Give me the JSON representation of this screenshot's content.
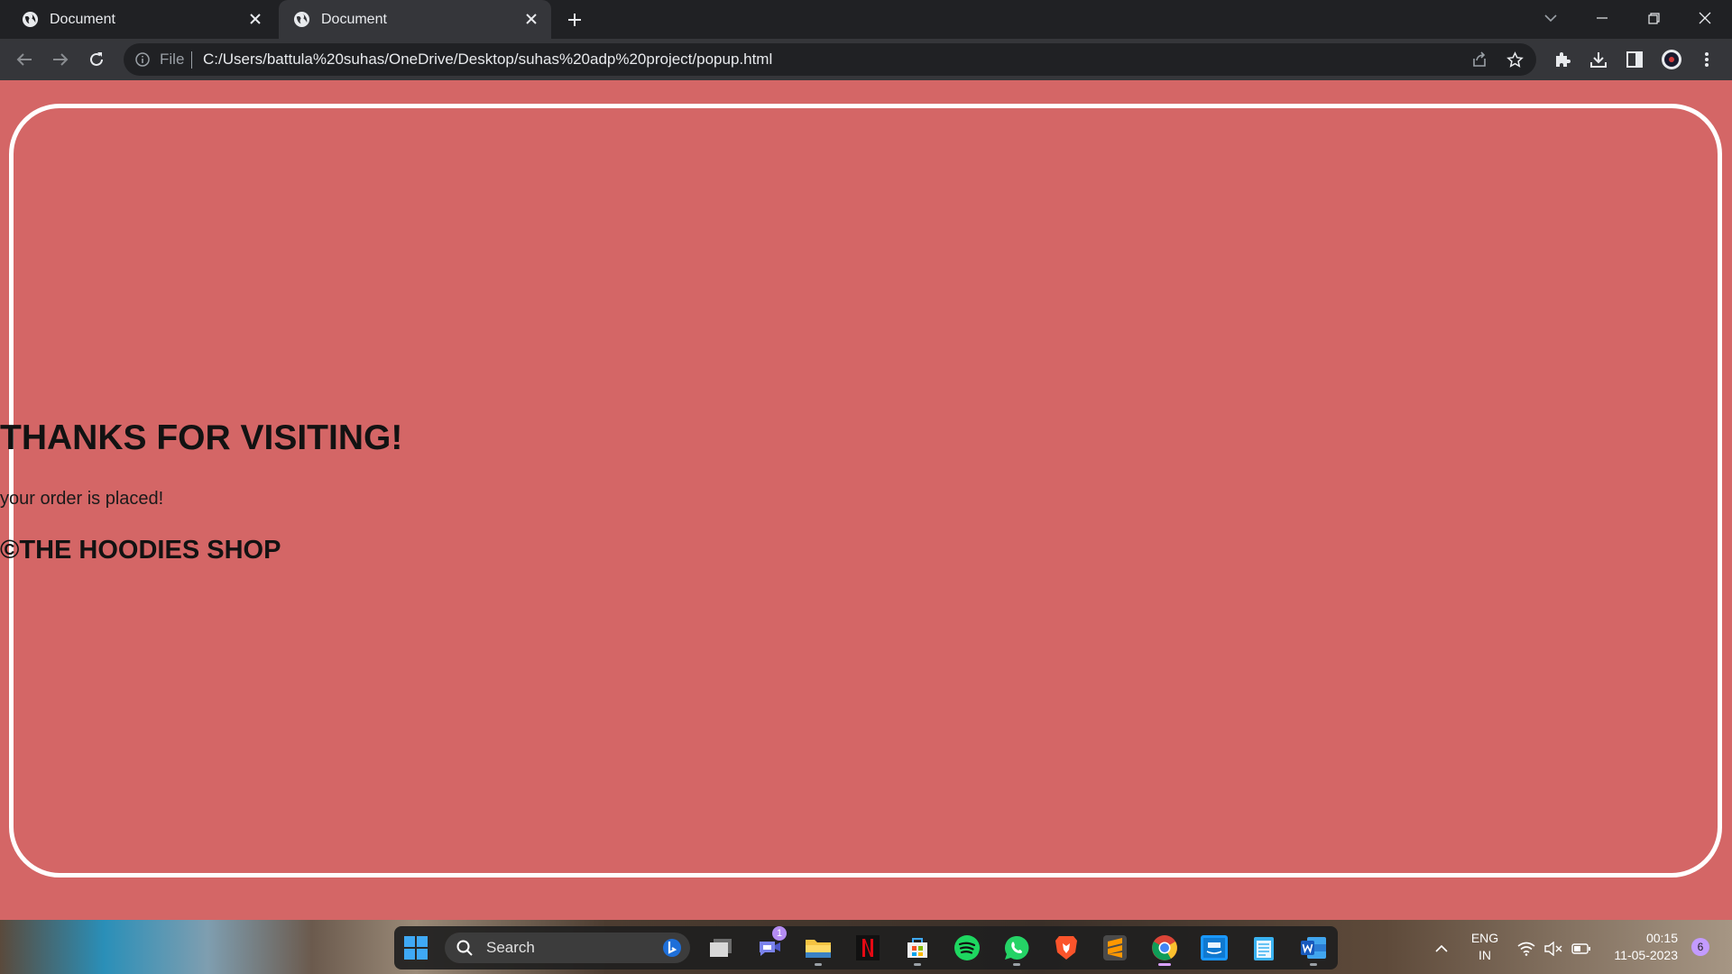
{
  "browser": {
    "tabs": [
      {
        "title": "Document",
        "active": false
      },
      {
        "title": "Document",
        "active": true
      }
    ],
    "address": {
      "scheme_label": "File",
      "url": "C:/Users/battula%20suhas/OneDrive/Desktop/suhas%20adp%20project/popup.html"
    }
  },
  "page": {
    "title": "THANKS FOR VISITING!",
    "subtitle": "your order is placed!",
    "brand": "©THE HOODIES SHOP",
    "background_color": "#d46666",
    "border_color": "#ffffff"
  },
  "taskbar": {
    "search_label": "Search",
    "chat_badge": "1",
    "language_line1": "ENG",
    "language_line2": "IN",
    "time": "00:15",
    "date": "11-05-2023",
    "notification_count": "6",
    "apps": [
      "start",
      "search",
      "task-view",
      "teams-chat",
      "file-explorer",
      "netflix",
      "microsoft-store",
      "spotify",
      "whatsapp",
      "brave",
      "sublime-text",
      "chrome",
      "prime-video",
      "notepad",
      "word"
    ]
  }
}
